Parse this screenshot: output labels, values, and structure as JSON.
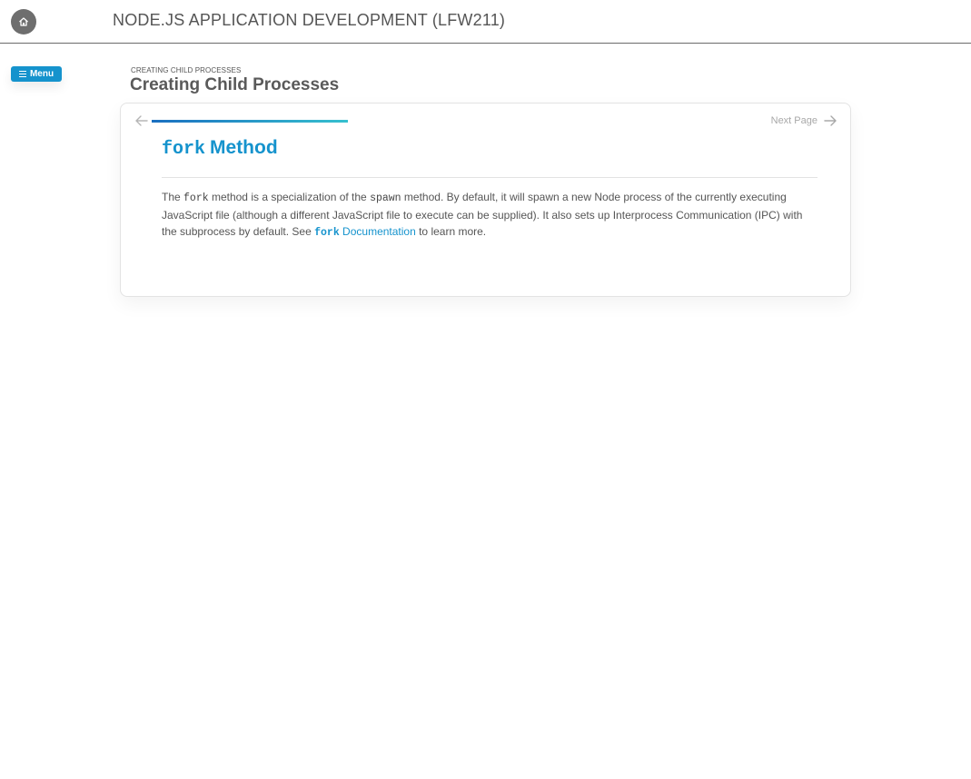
{
  "header": {
    "course_title": "NODE.JS APPLICATION DEVELOPMENT (LFW211)",
    "home_icon": "home-icon"
  },
  "menu": {
    "label": "Menu",
    "icon": "hamburger-icon"
  },
  "breadcrumb": "CREATING CHILD PROCESSES",
  "page_title": "Creating Child Processes",
  "card": {
    "nav": {
      "prev_icon": "arrow-left-icon",
      "next_label": "Next Page",
      "next_icon": "arrow-right-icon"
    },
    "heading": {
      "code": "fork",
      "text": "Method"
    },
    "paragraph": {
      "t1": "The ",
      "code1": "fork",
      "t2": " method is a specialization of the ",
      "code2": "spawn",
      "t3": " method. By default, it will spawn a new Node process of the currently executing JavaScript file (although a different JavaScript file to execute can be supplied). It also sets up Interprocess Communication (IPC) with the subprocess by default. See ",
      "link_code": "fork",
      "link_text": " Documentation",
      "t4": " to learn more."
    }
  },
  "colors": {
    "accent": "#1593cd",
    "home_button": "#6e6e6e",
    "progress_start": "#1a6fc0",
    "progress_end": "#36c0cf"
  }
}
